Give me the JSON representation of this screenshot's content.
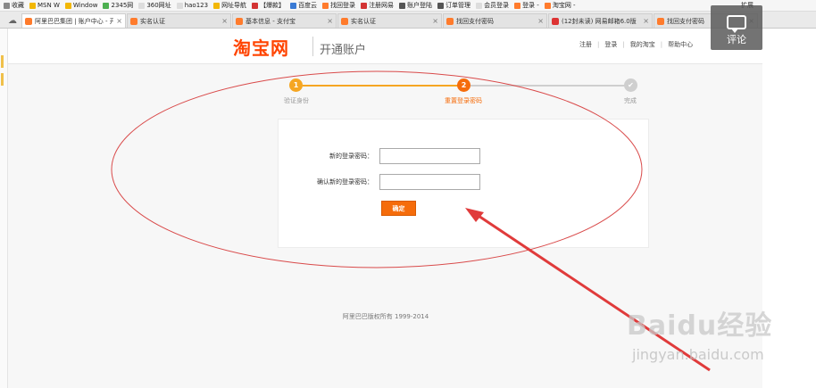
{
  "bookmarks": [
    {
      "label": "收藏",
      "color": "#888888"
    },
    {
      "label": "MSN W",
      "color": "#f2b705"
    },
    {
      "label": "Window",
      "color": "#f2b705"
    },
    {
      "label": "2345网",
      "color": "#4caf50"
    },
    {
      "label": "360网址",
      "color": "#dddddd"
    },
    {
      "label": "hao123",
      "color": "#dddddd"
    },
    {
      "label": "网址导航",
      "color": "#f2b705"
    },
    {
      "label": "【爆款】",
      "color": "#d33333"
    },
    {
      "label": "百度云",
      "color": "#3a7bd5"
    },
    {
      "label": "找回登录",
      "color": "#ff7b2c"
    },
    {
      "label": "注册网易",
      "color": "#d33333"
    },
    {
      "label": "账户登陆",
      "color": "#555555"
    },
    {
      "label": "订单管理",
      "color": "#555555"
    },
    {
      "label": "会员登录",
      "color": "#dddddd"
    },
    {
      "label": "登录 -",
      "color": "#ff7b2c"
    },
    {
      "label": "淘宝网 -",
      "color": "#ff7b2c"
    }
  ],
  "bookmarks_right": "扩展",
  "tabs": [
    {
      "title": "阿里巴巴集团 | 账户中心 - 开",
      "active": true,
      "fav": "orange"
    },
    {
      "title": "实名认证",
      "active": false,
      "fav": "orange"
    },
    {
      "title": "基本信息 - 支付宝",
      "active": false,
      "fav": "orange"
    },
    {
      "title": "实名认证",
      "active": false,
      "fav": "orange"
    },
    {
      "title": "找回支付密码",
      "active": false,
      "fav": "orange"
    },
    {
      "title": "(12封未读) 网易邮箱6.0版",
      "active": false,
      "fav": "red"
    },
    {
      "title": "找回支付密码",
      "active": false,
      "fav": "orange"
    }
  ],
  "header": {
    "logo": "淘宝网",
    "subtitle": "开通账户",
    "nav": [
      "注册",
      "登录",
      "我的淘宝",
      "帮助中心"
    ]
  },
  "steps": [
    {
      "num": "1",
      "label": "验证身份",
      "state": "done"
    },
    {
      "num": "2",
      "label": "重置登录密码",
      "state": "current"
    },
    {
      "num": "✔",
      "label": "完成",
      "state": "todo"
    }
  ],
  "form": {
    "new_password_label": "新的登录密码：",
    "confirm_password_label": "确认新的登录密码：",
    "submit_label": "确定"
  },
  "footer": {
    "copyright": "阿里巴巴版权所有 1999-2014"
  },
  "overlay": {
    "comment_label": "评论",
    "watermark_brand": "Baidu经验",
    "watermark_site": "jingyan.baidu.com"
  },
  "colors": {
    "accent": "#ff4400",
    "step_active": "#f5a623",
    "button": "#f56c0b",
    "annotation": "#d94a4a"
  }
}
